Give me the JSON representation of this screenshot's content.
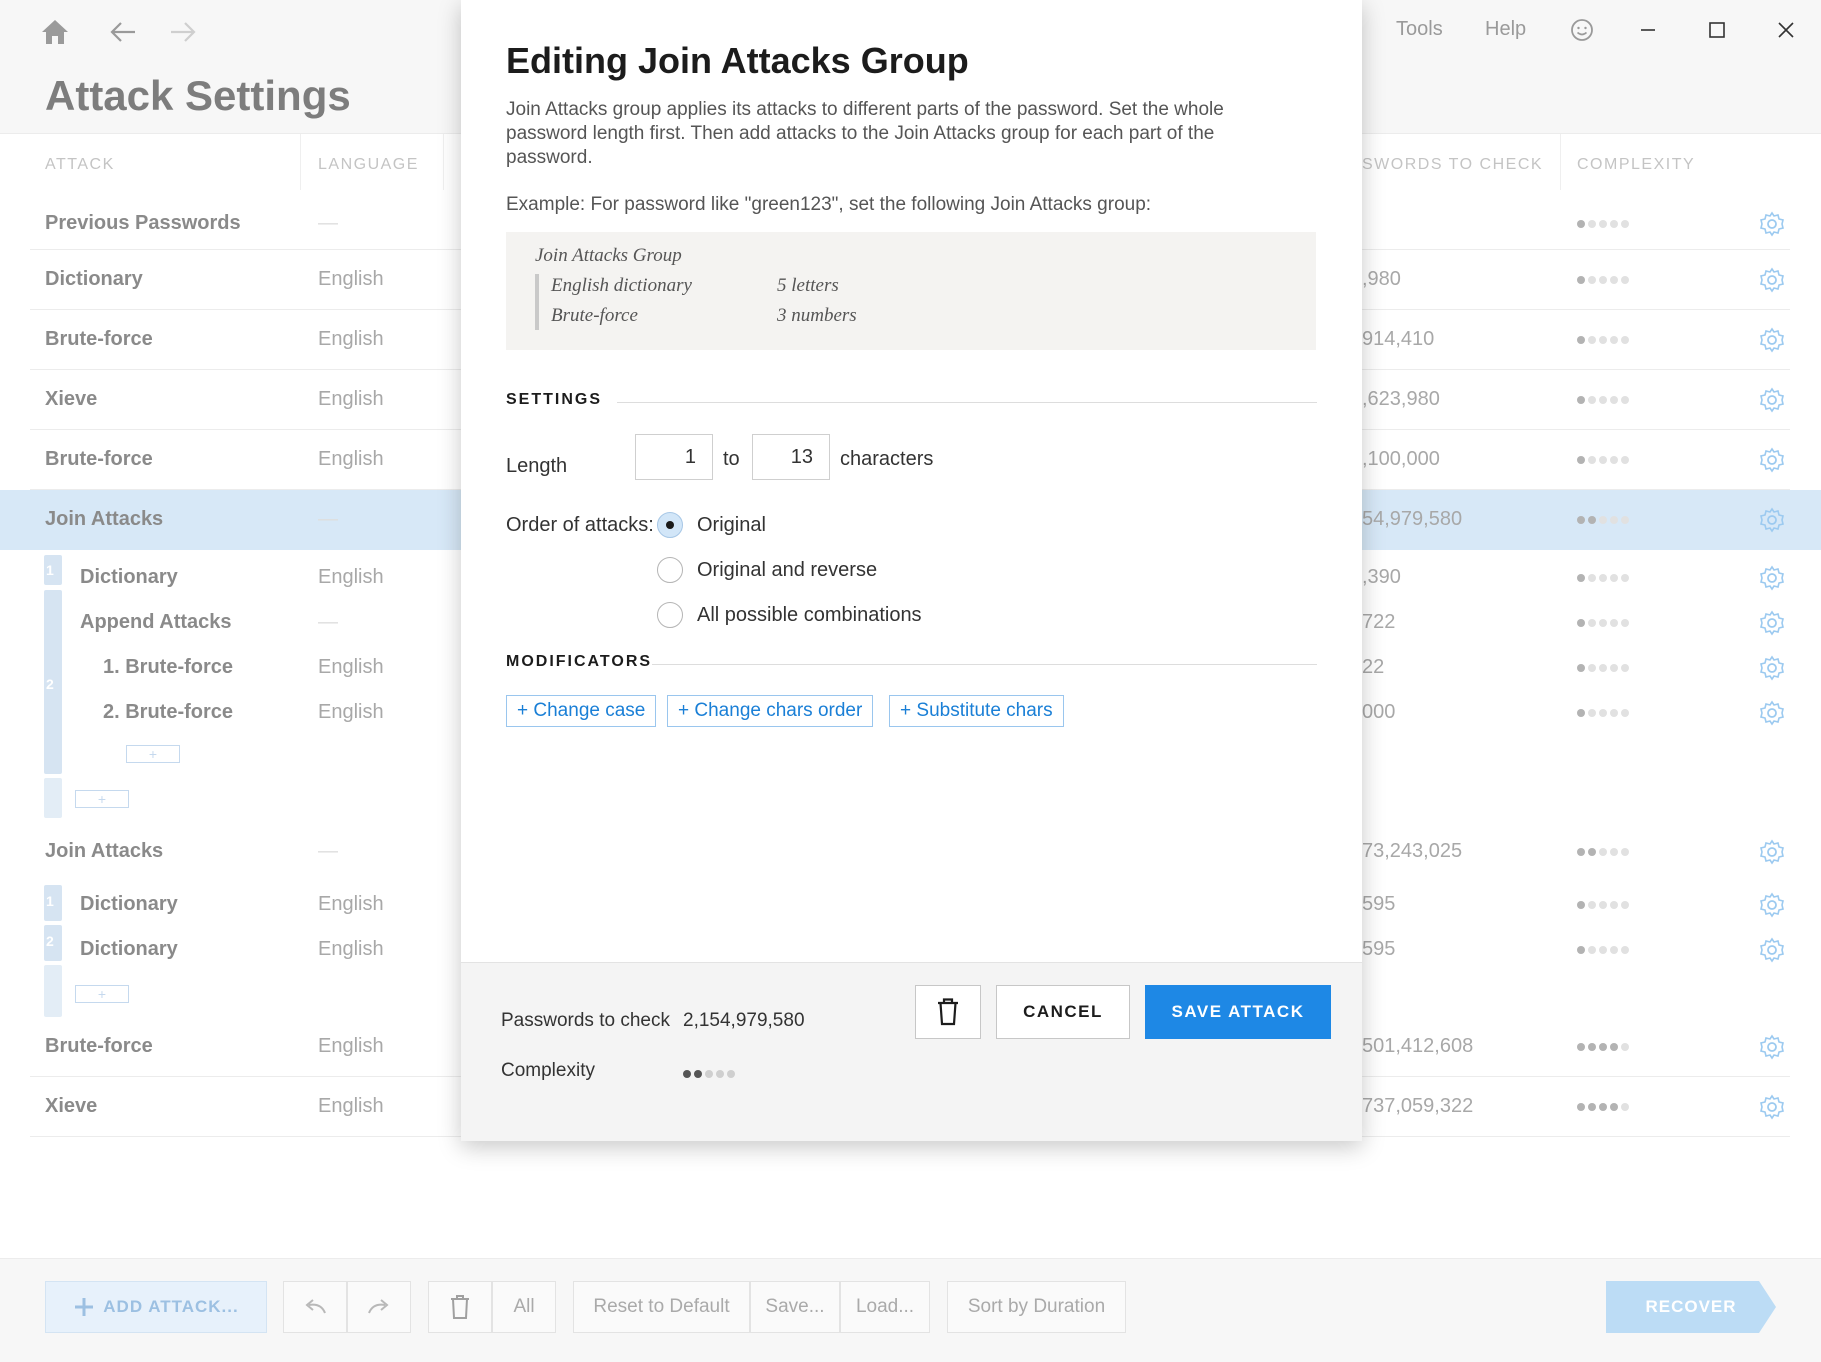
{
  "app": {
    "page_title": "Attack Settings",
    "menu": {
      "tools": "Tools",
      "help": "Help"
    },
    "columns": {
      "attack": "ATTACK",
      "language": "LANGUAGE",
      "passwords": "SWORDS TO CHECK",
      "complexity": "COMPLEXITY"
    },
    "rows": [
      {
        "name": "Previous Passwords",
        "language": "—",
        "passwords": "",
        "complexity": 1
      },
      {
        "name": "Dictionary",
        "language": "English",
        "passwords": ",980",
        "complexity": 1
      },
      {
        "name": "Brute-force",
        "language": "English",
        "passwords": "914,410",
        "complexity": 1
      },
      {
        "name": "Xieve",
        "language": "English",
        "passwords": ",623,980",
        "complexity": 1
      },
      {
        "name": "Brute-force",
        "language": "English",
        "passwords": ",100,000",
        "complexity": 1
      },
      {
        "name": "Join Attacks",
        "language": "—",
        "passwords": "54,979,580",
        "complexity": 2
      },
      {
        "name": "Dictionary",
        "language": "English",
        "passwords": ",390",
        "complexity": 1
      },
      {
        "name": "Append Attacks",
        "language": "—",
        "passwords": "722",
        "complexity": 1
      },
      {
        "name": "1. Brute-force",
        "language": "English",
        "passwords": "22",
        "complexity": 1
      },
      {
        "name": "2. Brute-force",
        "language": "English",
        "passwords": "000",
        "complexity": 1
      },
      {
        "name": "Join Attacks",
        "language": "—",
        "passwords": "73,243,025",
        "complexity": 2
      },
      {
        "name": "Dictionary",
        "language": "English",
        "passwords": "595",
        "complexity": 1
      },
      {
        "name": "Dictionary",
        "language": "English",
        "passwords": "595",
        "complexity": 1
      },
      {
        "name": "Brute-force",
        "language": "English",
        "passwords": "501,412,608",
        "complexity": 4
      },
      {
        "name": "Xieve",
        "language": "English",
        "passwords": "737,059,322",
        "complexity": 4
      }
    ],
    "segments": {
      "one": "1",
      "two": "2"
    },
    "mini_add": "+",
    "bottom": {
      "add_attack": "ADD ATTACK...",
      "all": "All",
      "reset": "Reset to Default",
      "save": "Save...",
      "load": "Load...",
      "sort": "Sort by Duration",
      "recover": "RECOVER"
    }
  },
  "modal": {
    "title": "Editing Join Attacks Group",
    "description": "Join Attacks group applies its attacks to different parts of the password. Set the whole password length first. Then add attacks to the Join Attacks group for each part of the password.",
    "example_label": "Example: For password like \"green123\", set the following Join Attacks group:",
    "example": {
      "head": "Join Attacks Group",
      "items": [
        {
          "name": "English dictionary",
          "detail": "5 letters"
        },
        {
          "name": "Brute-force",
          "detail": "3 numbers"
        }
      ]
    },
    "settings_title": "SETTINGS",
    "length_label": "Length",
    "length_from": "1",
    "to_label": "to",
    "length_to": "13",
    "characters_label": "characters",
    "order_label": "Order of attacks:",
    "order_options": [
      "Original",
      "Original and reverse",
      "All possible combinations"
    ],
    "order_selected": "Original",
    "modificators_title": "MODIFICATORS",
    "modificators": [
      "Change case",
      "Change chars order",
      "Substitute chars"
    ],
    "footer": {
      "passwords_label": "Passwords to check",
      "passwords_value": "2,154,979,580",
      "complexity_label": "Complexity",
      "complexity": 2,
      "cancel": "CANCEL",
      "save": "SAVE ATTACK"
    }
  },
  "colors": {
    "accent": "#1e88e5",
    "selected_row": "#d7e8f7",
    "link_blue": "#1a7fd6"
  }
}
